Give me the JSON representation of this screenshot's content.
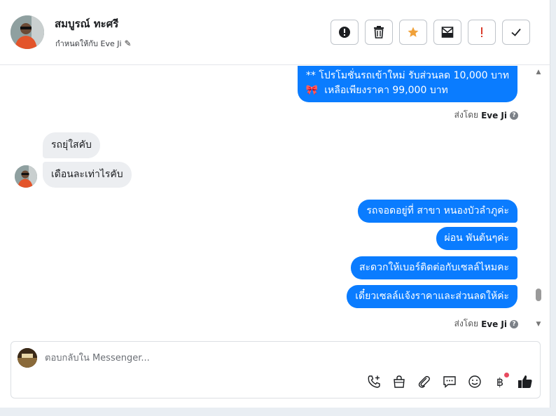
{
  "header": {
    "contact_name": "สมบูรณ์ ทะศรี",
    "assigned_to": "กำหนดให้กับ Eve Ji"
  },
  "toolbar": {
    "buttons": [
      {
        "icon": "alert-circle-icon"
      },
      {
        "icon": "trash-icon"
      },
      {
        "icon": "star-icon",
        "color": "#f0a13a"
      },
      {
        "icon": "archive-mail-icon"
      },
      {
        "icon": "exclamation-icon",
        "color": "#d93a2a"
      },
      {
        "icon": "check-icon"
      }
    ]
  },
  "messages": {
    "top_bubble": {
      "line1": "** โปรโมชั่นรถเข้าใหม่ รับส่วนลด 10,000 บาท",
      "line2": "เหลือเพียงราคา 99,000 บาท",
      "emoji": "🎀"
    },
    "sent_by_1": {
      "prefix": "ส่งโดย",
      "name": "Eve Ji"
    },
    "incoming": [
      "รถยุ่ใสคับ",
      "เดือนละเท่าไรคับ"
    ],
    "outgoing": [
      "รถจอดอยู่ที่ สาขา หนองบัวลำภูค่ะ",
      "ผ่อน พันต้นๆค่ะ",
      "สะดวกให้เบอร์ติดต่อกับเซลล์ไหมคะ",
      "เดี๋ยวเซลล์แจ้งราคาและส่วนลดให้ค่ะ"
    ],
    "sent_by_2": {
      "prefix": "ส่งโดย",
      "name": "Eve Ji"
    }
  },
  "composer": {
    "placeholder": "ตอบกลับใน Messenger...",
    "tools": [
      "call-add-icon",
      "shopping-bag-icon",
      "paperclip-icon",
      "chat-bubble-icon",
      "emoji-icon",
      "baht-icon",
      "thumbs-up-icon"
    ]
  },
  "colors": {
    "outgoing_bubble": "#0a7cff",
    "incoming_bubble": "#eceef1",
    "star": "#f0a13a",
    "alert_red": "#d93a2a"
  }
}
